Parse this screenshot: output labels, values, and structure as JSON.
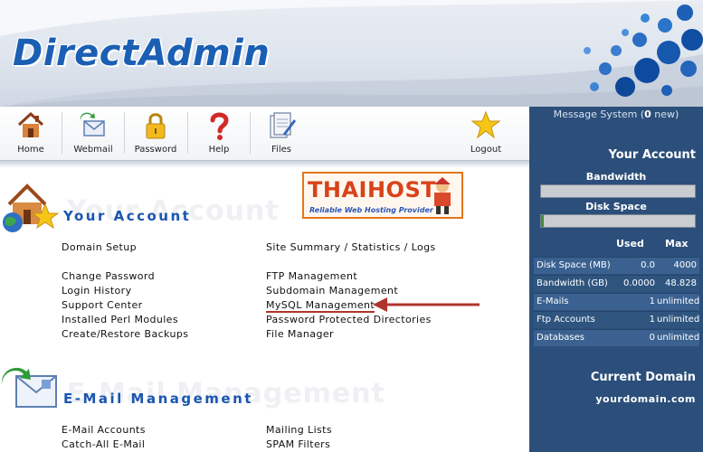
{
  "brand": {
    "logo_text": "DirectAdmin"
  },
  "toolbar": {
    "items": [
      {
        "label": "Home",
        "icon": "home-icon"
      },
      {
        "label": "Webmail",
        "icon": "webmail-icon"
      },
      {
        "label": "Password",
        "icon": "lock-icon"
      },
      {
        "label": "Help",
        "icon": "help-icon"
      },
      {
        "label": "Files",
        "icon": "files-icon"
      },
      {
        "label": "Logout",
        "icon": "star-icon"
      }
    ]
  },
  "banner": {
    "title": "THAIHOST",
    "tagline": "Reliable Web Hosting Provider"
  },
  "sections": {
    "account": {
      "title": "Your Account",
      "left_links": [
        "Domain Setup",
        "Change Password",
        "Login History",
        "Support Center",
        "Installed Perl Modules",
        "Create/Restore Backups"
      ],
      "right_links": [
        "Site Summary / Statistics / Logs",
        "FTP Management",
        "Subdomain Management",
        "MySQL Management",
        "Password Protected Directories",
        "File Manager"
      ]
    },
    "email": {
      "title": "E-Mail Management",
      "left_links": [
        "E-Mail Accounts",
        "Catch-All E-Mail"
      ],
      "right_links": [
        "Mailing Lists",
        "SPAM Filters"
      ]
    }
  },
  "panel": {
    "message_prefix": "Message System (",
    "message_count": "0",
    "message_suffix": " new)",
    "account_heading": "Your Account",
    "bandwidth_label": "Bandwidth",
    "diskspace_label": "Disk Space",
    "bandwidth_usage_fraction": 0.0,
    "diskspace_usage_fraction": 0.0,
    "col_used": "Used",
    "col_max": "Max",
    "rows": [
      {
        "label": "Disk Space (MB)",
        "used": "0.0",
        "max": "4000"
      },
      {
        "label": "Bandwidth (GB)",
        "used": "0.0000",
        "max": "48.828"
      },
      {
        "label": "E-Mails",
        "used": "1",
        "max": "unlimited"
      },
      {
        "label": "Ftp Accounts",
        "used": "1",
        "max": "unlimited"
      },
      {
        "label": "Databases",
        "used": "0",
        "max": "unlimited"
      }
    ],
    "domain_heading": "Current Domain",
    "domain_value": "yourdomain.com"
  },
  "colors": {
    "accent": "#1a56b0",
    "panel": "#2b4f7a",
    "arrow": "#b0352d"
  }
}
